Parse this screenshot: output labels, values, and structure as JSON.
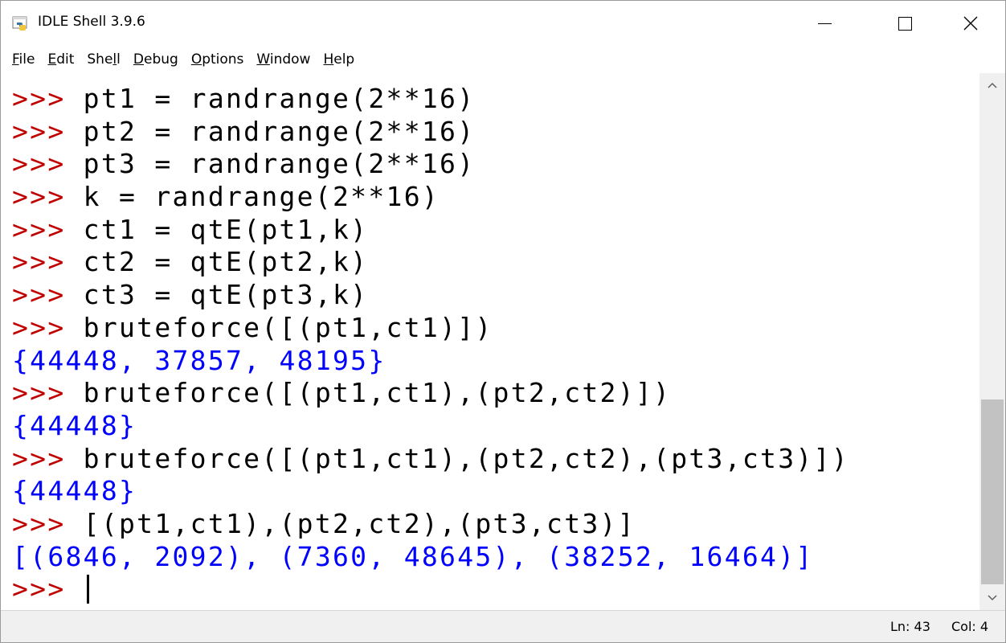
{
  "window": {
    "title": "IDLE Shell 3.9.6",
    "icon": "python-idle-icon"
  },
  "menubar": {
    "items": [
      {
        "pre": "",
        "ul": "F",
        "post": "ile"
      },
      {
        "pre": "",
        "ul": "E",
        "post": "dit"
      },
      {
        "pre": "She",
        "ul": "l",
        "post": "l"
      },
      {
        "pre": "",
        "ul": "D",
        "post": "ebug"
      },
      {
        "pre": "",
        "ul": "O",
        "post": "ptions"
      },
      {
        "pre": "",
        "ul": "W",
        "post": "indow"
      },
      {
        "pre": "",
        "ul": "H",
        "post": "elp"
      }
    ]
  },
  "shell": {
    "prompt": ">>> ",
    "lines": [
      {
        "type": "input",
        "text": "pt1 = randrange(2**16)"
      },
      {
        "type": "input",
        "text": "pt2 = randrange(2**16)"
      },
      {
        "type": "input",
        "text": "pt3 = randrange(2**16)"
      },
      {
        "type": "input",
        "text": "k = randrange(2**16)"
      },
      {
        "type": "input",
        "text": "ct1 = qtE(pt1,k)"
      },
      {
        "type": "input",
        "text": "ct2 = qtE(pt2,k)"
      },
      {
        "type": "input",
        "text": "ct3 = qtE(pt3,k)"
      },
      {
        "type": "input",
        "text": "bruteforce([(pt1,ct1)])"
      },
      {
        "type": "output",
        "text": "{44448, 37857, 48195}"
      },
      {
        "type": "input",
        "text": "bruteforce([(pt1,ct1),(pt2,ct2)])"
      },
      {
        "type": "output",
        "text": "{44448}"
      },
      {
        "type": "input",
        "text": "bruteforce([(pt1,ct1),(pt2,ct2),(pt3,ct3)])"
      },
      {
        "type": "output",
        "text": "{44448}"
      },
      {
        "type": "input",
        "text": "[(pt1,ct1),(pt2,ct2),(pt3,ct3)]"
      },
      {
        "type": "output",
        "text": "[(6846, 2092), (7360, 48645), (38252, 16464)]"
      },
      {
        "type": "current",
        "text": ""
      }
    ]
  },
  "statusbar": {
    "ln": "Ln: 43",
    "col": "Col: 4"
  },
  "colors": {
    "prompt": "#c00000",
    "code": "#000000",
    "output": "#0000ff"
  }
}
